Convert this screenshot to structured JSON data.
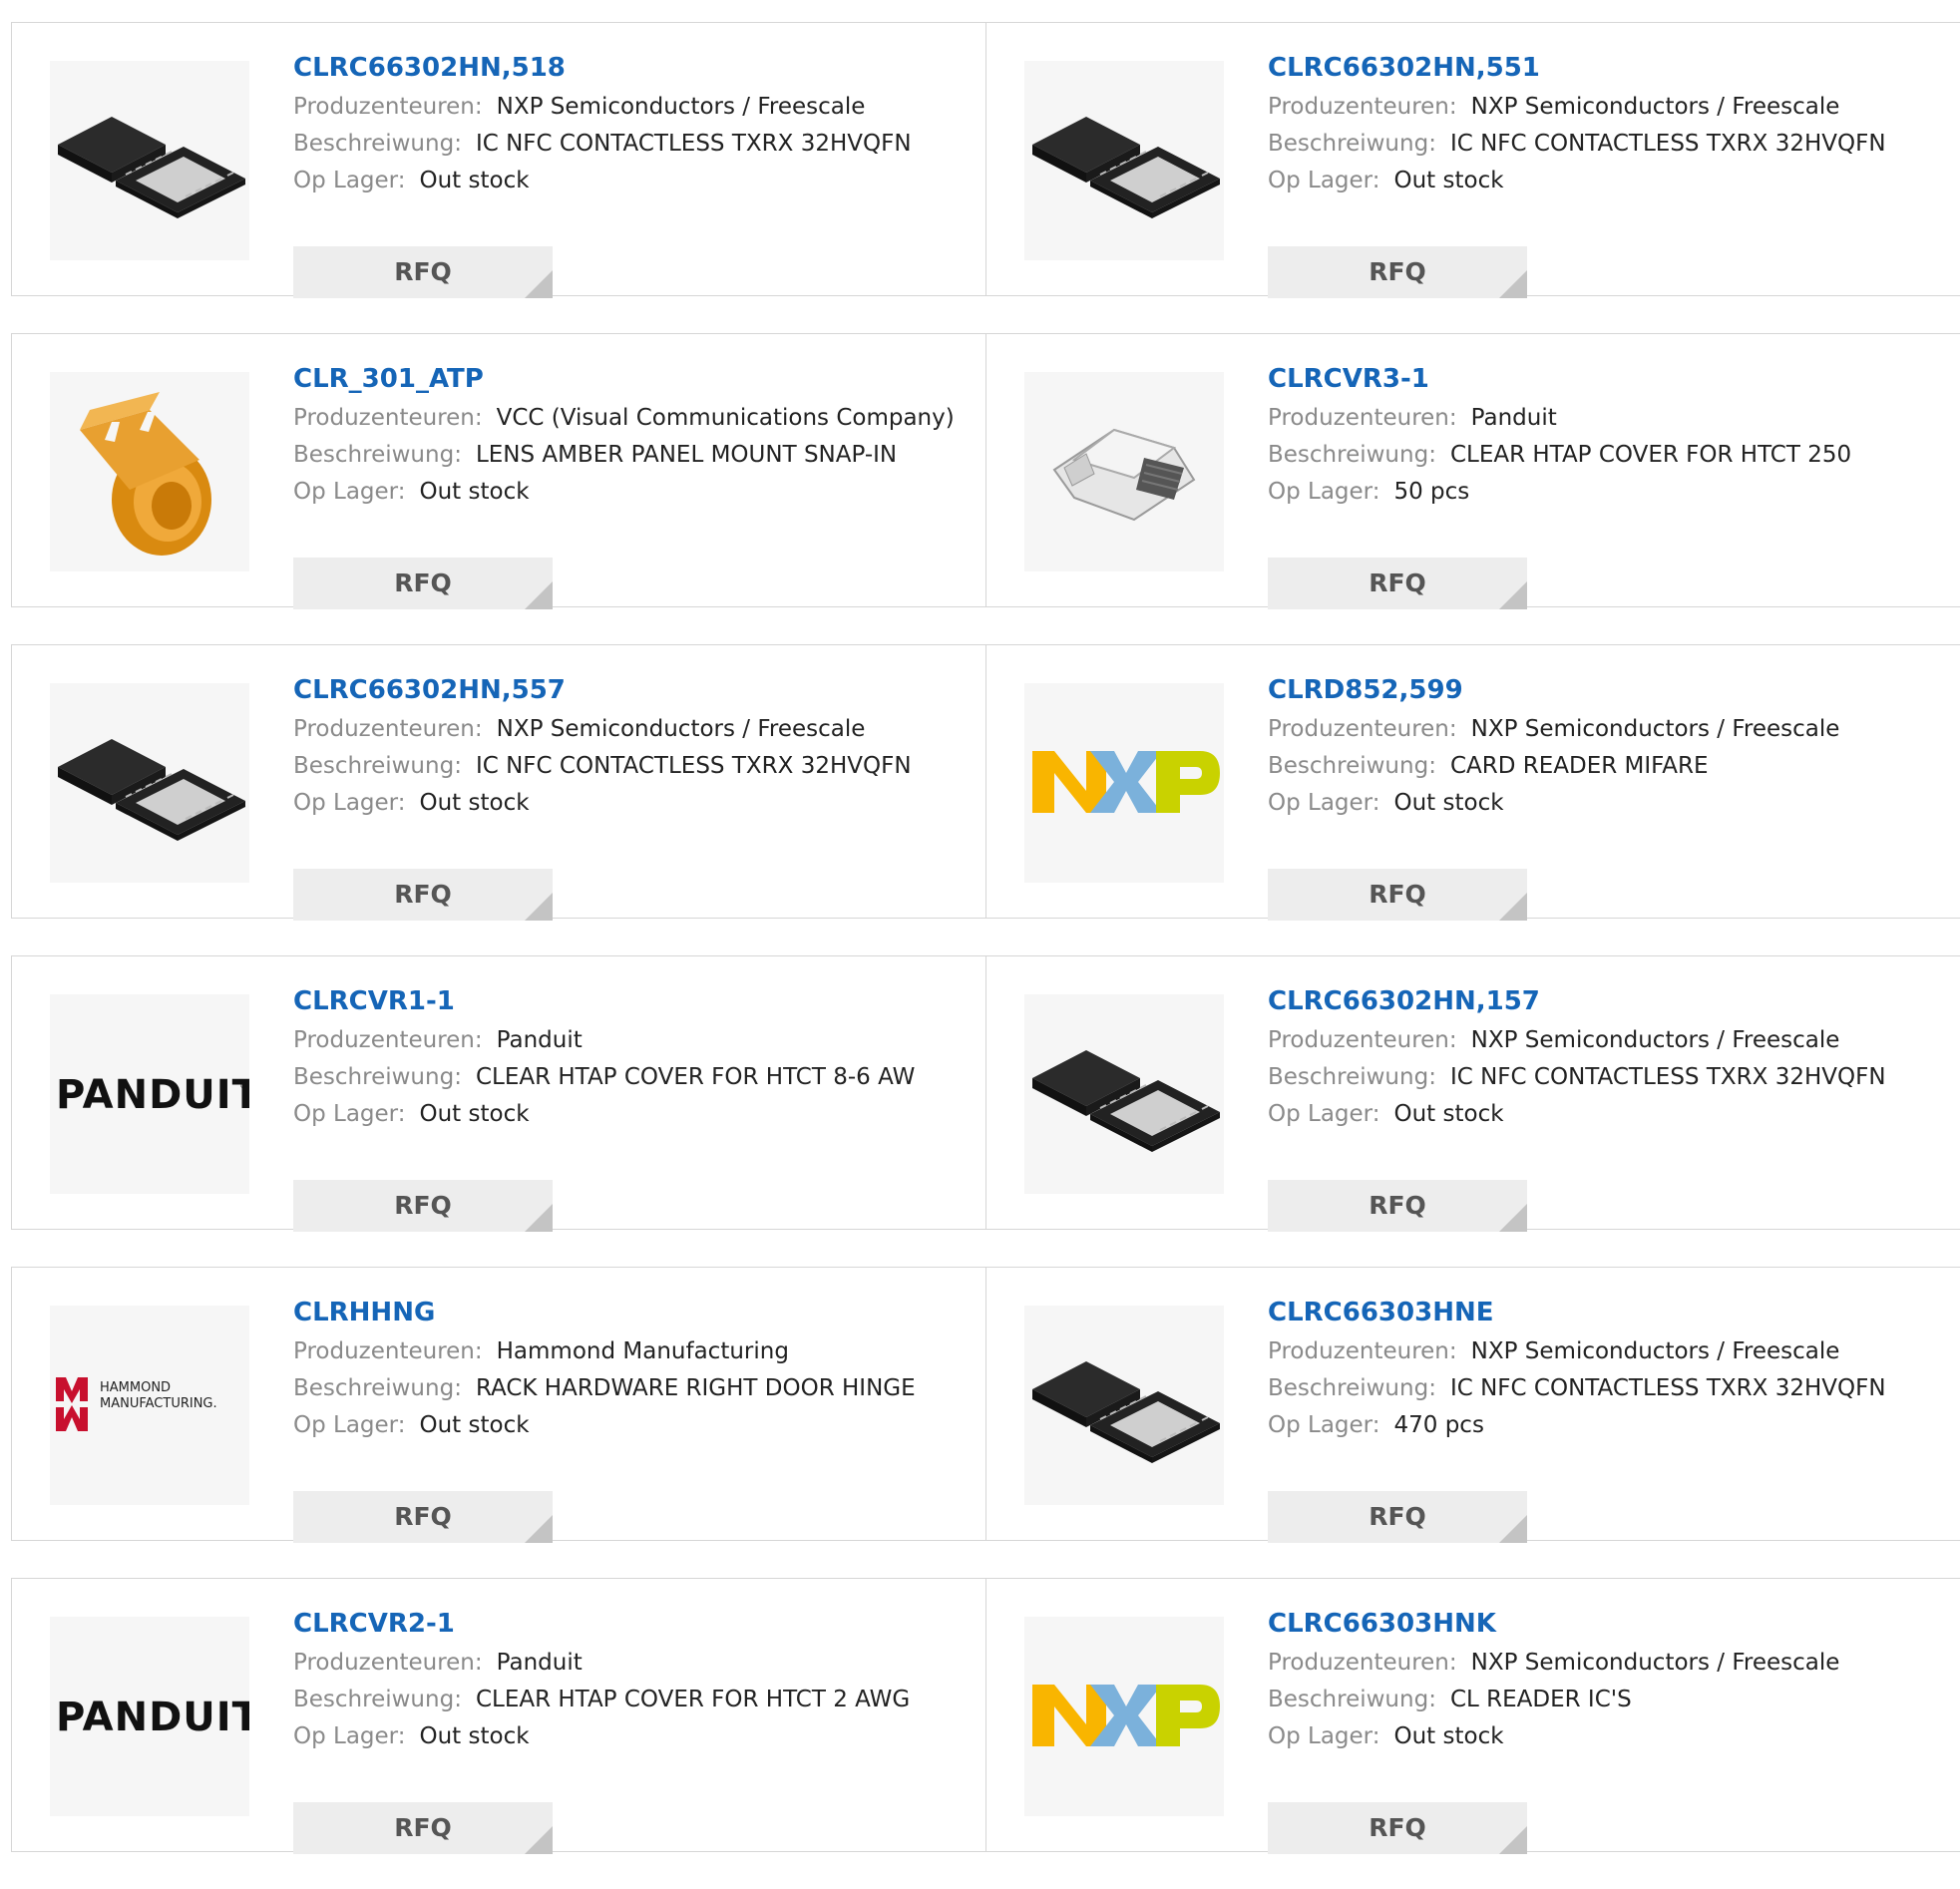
{
  "labels": {
    "manufacturer": "Produzenteuren:",
    "description": "Beschreiwung:",
    "stock": "Op Lager:",
    "rfq": "RFQ"
  },
  "products": [
    {
      "part": "CLRC66302HN,518",
      "manufacturer": "NXP Semiconductors / Freescale",
      "description": "IC NFC CONTACTLESS TXRX 32HVQFN",
      "stock": "Out stock",
      "image": "qfn-chip-icon"
    },
    {
      "part": "CLRC66302HN,551",
      "manufacturer": "NXP Semiconductors / Freescale",
      "description": "IC NFC CONTACTLESS TXRX 32HVQFN",
      "stock": "Out stock",
      "image": "qfn-chip-icon"
    },
    {
      "part": "CLR_301_ATP",
      "manufacturer": "VCC (Visual Communications Company)",
      "description": "LENS AMBER PANEL MOUNT SNAP-IN",
      "stock": "Out stock",
      "image": "amber-lens-icon"
    },
    {
      "part": "CLRCVR3-1",
      "manufacturer": "Panduit",
      "description": "CLEAR HTAP COVER FOR HTCT 250",
      "stock": "50 pcs",
      "image": "clear-cover-icon"
    },
    {
      "part": "CLRC66302HN,557",
      "manufacturer": "NXP Semiconductors / Freescale",
      "description": "IC NFC CONTACTLESS TXRX 32HVQFN",
      "stock": "Out stock",
      "image": "qfn-chip-icon"
    },
    {
      "part": "CLRD852,599",
      "manufacturer": "NXP Semiconductors / Freescale",
      "description": "CARD READER MIFARE",
      "stock": "Out stock",
      "image": "nxp-logo"
    },
    {
      "part": "CLRCVR1-1",
      "manufacturer": "Panduit",
      "description": "CLEAR HTAP COVER FOR HTCT 8-6 AW",
      "stock": "Out stock",
      "image": "panduit-logo"
    },
    {
      "part": "CLRC66302HN,157",
      "manufacturer": "NXP Semiconductors / Freescale",
      "description": "IC NFC CONTACTLESS TXRX 32HVQFN",
      "stock": "Out stock",
      "image": "qfn-chip-icon"
    },
    {
      "part": "CLRHHNG",
      "manufacturer": "Hammond Manufacturing",
      "description": "RACK HARDWARE RIGHT DOOR HINGE",
      "stock": "Out stock",
      "image": "hammond-logo"
    },
    {
      "part": "CLRC66303HNE",
      "manufacturer": "NXP Semiconductors / Freescale",
      "description": "IC NFC CONTACTLESS TXRX 32HVQFN",
      "stock": "470 pcs",
      "image": "qfn-chip-icon"
    },
    {
      "part": "CLRCVR2-1",
      "manufacturer": "Panduit",
      "description": "CLEAR HTAP COVER FOR HTCT 2 AWG",
      "stock": "Out stock",
      "image": "panduit-logo"
    },
    {
      "part": "CLRC66303HNK",
      "manufacturer": "NXP Semiconductors / Freescale",
      "description": "CL READER IC'S",
      "stock": "Out stock",
      "image": "nxp-logo"
    }
  ],
  "logos": {
    "panduit": "PANDUIT",
    "hammond_line1": "HAMMOND",
    "hammond_line2": "MANUFACTURING."
  },
  "colors": {
    "link": "#1565b7",
    "label": "#8a8a8a",
    "nxp_orange": "#f9b500",
    "nxp_blue": "#7bb1db",
    "nxp_green": "#c9d200",
    "hammond_red": "#c8102e"
  }
}
